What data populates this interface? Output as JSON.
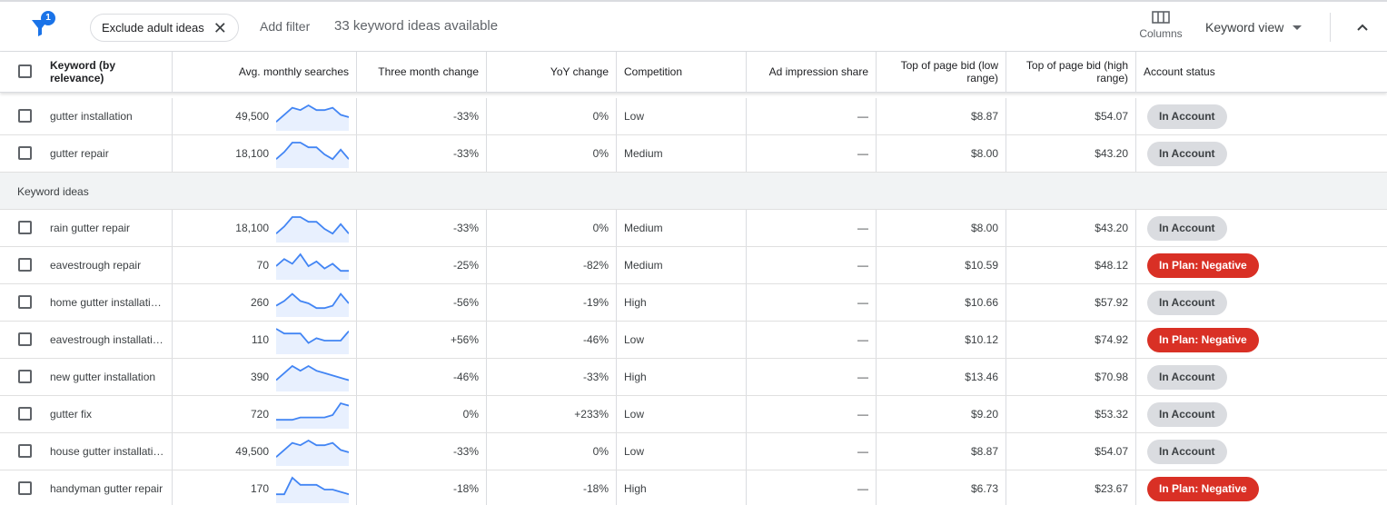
{
  "toolbar": {
    "filter_count": "1",
    "chip_label": "Exclude adult ideas",
    "add_filter": "Add filter",
    "ideas_count": "33 keyword ideas available",
    "columns": "Columns",
    "keyword_view": "Keyword view"
  },
  "columns": {
    "keyword": "Keyword (by relevance)",
    "avg": "Avg. monthly searches",
    "three_month": "Three month change",
    "yoy": "YoY change",
    "competition": "Competition",
    "impression": "Ad impression share",
    "bid_low": "Top of page bid (low range)",
    "bid_high": "Top of page bid (high range)",
    "status": "Account status"
  },
  "section_label": "Keyword ideas",
  "colors": {
    "accent": "#1a73e8",
    "spark_line": "#4285f4",
    "spark_fill": "#e8f0fe",
    "negative": "#d93025",
    "in_account": "#dadce0"
  },
  "rows": [
    {
      "keyword": "gutter installation",
      "avg": "49,500",
      "three_month": "-33%",
      "yoy": "0%",
      "competition": "Low",
      "impression": "—",
      "bid_low": "$8.87",
      "bid_high": "$54.07",
      "status": "In Account",
      "status_type": "account",
      "trend": [
        3,
        6,
        9,
        8,
        10,
        8,
        8,
        9,
        6,
        5
      ]
    },
    {
      "keyword": "gutter repair",
      "avg": "18,100",
      "three_month": "-33%",
      "yoy": "0%",
      "competition": "Medium",
      "impression": "—",
      "bid_low": "$8.00",
      "bid_high": "$43.20",
      "status": "In Account",
      "status_type": "account",
      "trend": [
        3,
        6,
        10,
        10,
        8,
        8,
        5,
        3,
        7,
        3
      ]
    },
    {
      "keyword": "rain gutter repair",
      "avg": "18,100",
      "three_month": "-33%",
      "yoy": "0%",
      "competition": "Medium",
      "impression": "—",
      "bid_low": "$8.00",
      "bid_high": "$43.20",
      "status": "In Account",
      "status_type": "account",
      "trend": [
        3,
        6,
        10,
        10,
        8,
        8,
        5,
        3,
        7,
        3
      ]
    },
    {
      "keyword": "eavestrough repair",
      "avg": "70",
      "three_month": "-25%",
      "yoy": "-82%",
      "competition": "Medium",
      "impression": "—",
      "bid_low": "$10.59",
      "bid_high": "$48.12",
      "status": "In Plan: Negative",
      "status_type": "negative",
      "trend": [
        5,
        8,
        6,
        10,
        5,
        7,
        4,
        6,
        3,
        3
      ]
    },
    {
      "keyword": "home gutter installati…",
      "avg": "260",
      "three_month": "-56%",
      "yoy": "-19%",
      "competition": "High",
      "impression": "—",
      "bid_low": "$10.66",
      "bid_high": "$57.92",
      "status": "In Account",
      "status_type": "account",
      "trend": [
        4,
        6,
        9,
        6,
        5,
        3,
        3,
        4,
        9,
        5
      ]
    },
    {
      "keyword": "eavestrough installati…",
      "avg": "110",
      "three_month": "+56%",
      "yoy": "-46%",
      "competition": "Low",
      "impression": "—",
      "bid_low": "$10.12",
      "bid_high": "$74.92",
      "status": "In Plan: Negative",
      "status_type": "negative",
      "trend": [
        10,
        8,
        8,
        8,
        4,
        6,
        5,
        5,
        5,
        9
      ]
    },
    {
      "keyword": "new gutter installation",
      "avg": "390",
      "three_month": "-46%",
      "yoy": "-33%",
      "competition": "High",
      "impression": "—",
      "bid_low": "$13.46",
      "bid_high": "$70.98",
      "status": "In Account",
      "status_type": "account",
      "trend": [
        4,
        7,
        10,
        8,
        10,
        8,
        7,
        6,
        5,
        4
      ]
    },
    {
      "keyword": "gutter fix",
      "avg": "720",
      "three_month": "0%",
      "yoy": "+233%",
      "competition": "Low",
      "impression": "—",
      "bid_low": "$9.20",
      "bid_high": "$53.32",
      "status": "In Account",
      "status_type": "account",
      "trend": [
        3,
        3,
        3,
        4,
        4,
        4,
        4,
        5,
        10,
        9
      ]
    },
    {
      "keyword": "house gutter installati…",
      "avg": "49,500",
      "three_month": "-33%",
      "yoy": "0%",
      "competition": "Low",
      "impression": "—",
      "bid_low": "$8.87",
      "bid_high": "$54.07",
      "status": "In Account",
      "status_type": "account",
      "trend": [
        3,
        6,
        9,
        8,
        10,
        8,
        8,
        9,
        6,
        5
      ]
    },
    {
      "keyword": "handyman gutter repair",
      "avg": "170",
      "three_month": "-18%",
      "yoy": "-18%",
      "competition": "High",
      "impression": "—",
      "bid_low": "$6.73",
      "bid_high": "$23.67",
      "status": "In Plan: Negative",
      "status_type": "negative",
      "trend": [
        3,
        3,
        10,
        7,
        7,
        7,
        5,
        5,
        4,
        3
      ]
    }
  ]
}
